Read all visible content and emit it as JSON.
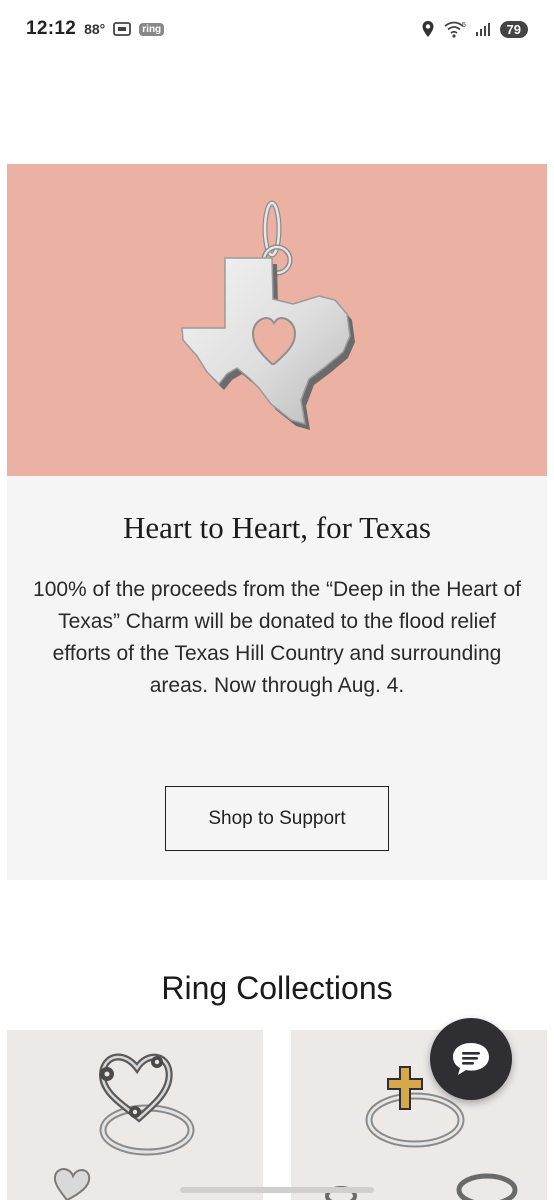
{
  "status_bar": {
    "time": "12:12",
    "temperature": "88°",
    "ring_app_label": "ring",
    "battery_level": "79",
    "icons": [
      "screenshot-icon",
      "ring-icon",
      "location-icon",
      "wifi-icon",
      "signal-icon",
      "battery-icon"
    ]
  },
  "promo": {
    "background_color": "#ebb1a2",
    "image_alt": "Deep in the Heart of Texas Charm",
    "title": "Heart to Heart, for Texas",
    "body": "100% of the proceeds from the “Deep in the Heart of Texas” Charm will be donated to the flood relief efforts of the Texas Hill Country and surrounding areas. Now through Aug. 4.",
    "cta_label": "Shop to Support"
  },
  "ring_collections": {
    "title": "Ring Collections",
    "tiles": [
      {
        "image": "floral-heart-ring"
      },
      {
        "image": "gold-cross-ring"
      }
    ]
  },
  "chat": {
    "icon": "chat-bubble-icon"
  }
}
